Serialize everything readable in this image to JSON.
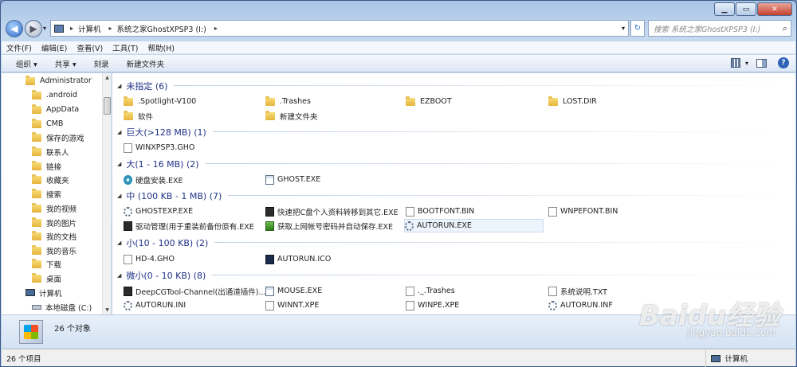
{
  "window": {
    "controls": [
      "minimize-icon",
      "maximize-icon",
      "close-icon"
    ]
  },
  "address_bar": {
    "segments": [
      "计算机",
      "系统之家GhostXPSP3 (I:)"
    ],
    "search_placeholder": "搜索 系统之家GhostXPSP3 (I:)"
  },
  "menu": [
    "文件(F)",
    "编辑(E)",
    "查看(V)",
    "工具(T)",
    "帮助(H)"
  ],
  "commands": [
    "组织 ▾",
    "共享 ▾",
    "刻录",
    "新建文件夹"
  ],
  "nav_tree": [
    {
      "label": "Administrator"
    },
    {
      "label": ".android"
    },
    {
      "label": "AppData"
    },
    {
      "label": "CMB"
    },
    {
      "label": "保存的游戏"
    },
    {
      "label": "联系人"
    },
    {
      "label": "链接"
    },
    {
      "label": "收藏夹"
    },
    {
      "label": "搜索"
    },
    {
      "label": "我的视频"
    },
    {
      "label": "我的图片"
    },
    {
      "label": "我的文档"
    },
    {
      "label": "我的音乐"
    },
    {
      "label": "下载"
    },
    {
      "label": "桌面"
    },
    {
      "label": "计算机"
    },
    {
      "label": "本地磁盘 (C:)"
    }
  ],
  "groups": [
    {
      "title": "未指定 (6)",
      "files": [
        ".Spotlight-V100",
        ".Trashes",
        "EZBOOT",
        "LOST.DIR",
        "软件",
        "新建文件夹"
      ]
    },
    {
      "title": "巨大(>128 MB) (1)",
      "files": [
        "WINXPSP3.GHO"
      ]
    },
    {
      "title": "大(1 - 16 MB) (2)",
      "files": [
        "硬盘安装.EXE",
        "GHOST.EXE"
      ]
    },
    {
      "title": "中 (100 KB - 1 MB) (7)",
      "files": [
        "GHOSTEXP.EXE",
        "快速把C盘个人资料转移到其它.EXE",
        "BOOTFONT.BIN",
        "WNPEFONT.BIN",
        "驱动管理(用于重装前备份原有.EXE",
        "获取上网帐号密码并自动保存.EXE",
        "AUTORUN.EXE"
      ]
    },
    {
      "title": "小(10 - 100 KB) (2)",
      "files": [
        "HD-4.GHO",
        "AUTORUN.ICO"
      ]
    },
    {
      "title": "微小(0 - 10 KB) (8)",
      "files": [
        "DeepCGTool-Channel(出通道插件)...",
        "MOUSE.EXE",
        "._.Trashes",
        "系统说明.TXT",
        "AUTORUN.INI",
        "WINNT.XPE",
        "WINPE.XPE",
        "AUTORUN.INF"
      ]
    }
  ],
  "details": {
    "count": "26 个对象"
  },
  "status": {
    "left": "26 个项目",
    "right": "计算机"
  },
  "watermark": {
    "main": "Baidu经验",
    "sub": "jingyan.baidu.com"
  }
}
